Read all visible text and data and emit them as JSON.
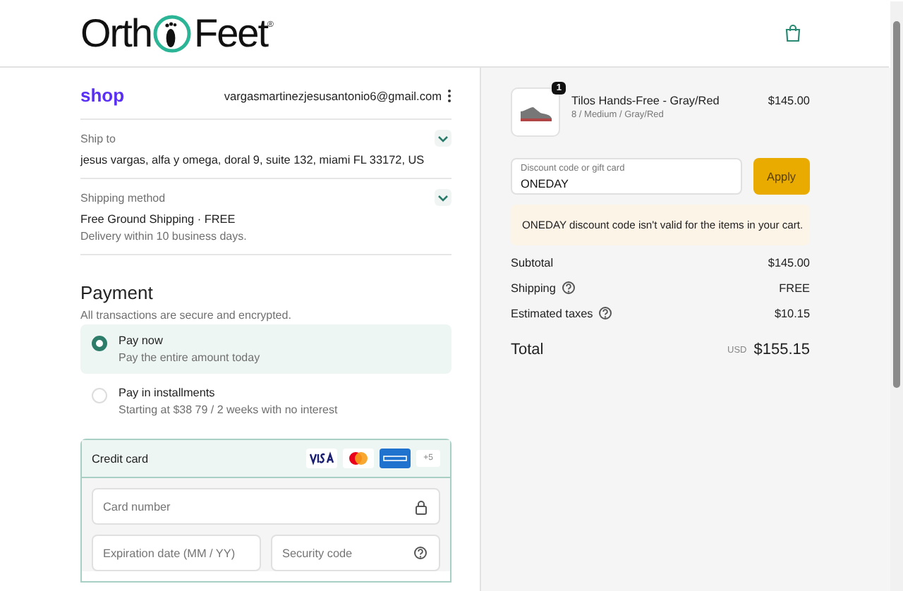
{
  "header": {
    "logo": {
      "first": "Orth",
      "second": "Feet",
      "mark": "®"
    }
  },
  "account": {
    "brand": "shop",
    "email": "vargasmartinezjesusantonio6@gmail.com"
  },
  "sections": [
    {
      "label": "Ship to",
      "lines": [
        {
          "kind": "main",
          "text": "jesus vargas, alfa y omega, doral 9, suite 132, miami FL 33172, US"
        }
      ]
    },
    {
      "label": "Shipping method",
      "lines": [
        {
          "kind": "main",
          "text": "Free Ground Shipping · FREE"
        },
        {
          "kind": "note",
          "text": "Delivery within 10 business days."
        }
      ]
    }
  ],
  "payment": {
    "title": "Payment",
    "subtitle": "All transactions are secure and encrypted.",
    "options": [
      {
        "label": "Pay now",
        "detail": "Pay the entire amount today",
        "selected": true
      },
      {
        "label": "Pay in installments",
        "detail": "Starting at $38 79 / 2 weeks with no interest",
        "selected": false
      }
    ],
    "method": {
      "label": "Credit card",
      "more": "+5"
    },
    "fields": [
      {
        "placeholder": "Card number",
        "kind": "lock"
      },
      {
        "placeholder": "Expiration date (MM / YY)",
        "kind": "plain"
      },
      {
        "placeholder": "Security code",
        "kind": "help"
      }
    ]
  },
  "order": {
    "item": {
      "name": "Tilos Hands-Free - Gray/Red",
      "variant": "8 / Medium / Gray/Red",
      "price": "$145.00",
      "quantity": "1"
    },
    "discount": {
      "label": "Discount code or gift card",
      "value": "ONEDAY",
      "button": "Apply"
    },
    "error": "ONEDAY discount code isn't valid for the items in your cart.",
    "summary": [
      {
        "label": "Subtotal",
        "value": "$145.00",
        "info": false
      },
      {
        "label": "Shipping",
        "value": "FREE",
        "info": true
      },
      {
        "label": "Estimated taxes",
        "value": "$10.15",
        "info": true
      }
    ],
    "total": {
      "label": "Total",
      "currency": "USD",
      "value": "$155.15"
    }
  }
}
